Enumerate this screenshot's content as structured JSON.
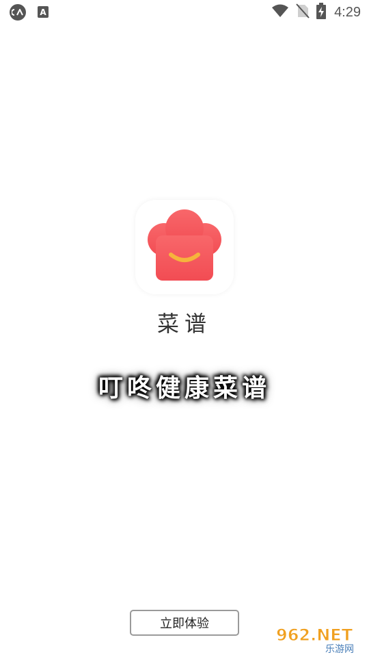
{
  "status_bar": {
    "time": "4:29",
    "left_icons": [
      "cast-icon",
      "font-icon"
    ],
    "right_icons": [
      "wifi-icon",
      "no-sim-icon",
      "battery-charging-icon"
    ],
    "font_icon_letter": "A"
  },
  "app": {
    "name": "菜谱",
    "icon": "chef-hat-icon",
    "brand_color": "#f4555a"
  },
  "splash": {
    "tagline": "叮咚健康菜谱"
  },
  "actions": {
    "start_label": "立即体验"
  },
  "watermark": {
    "main": "962.NET",
    "sub": "乐游网"
  }
}
